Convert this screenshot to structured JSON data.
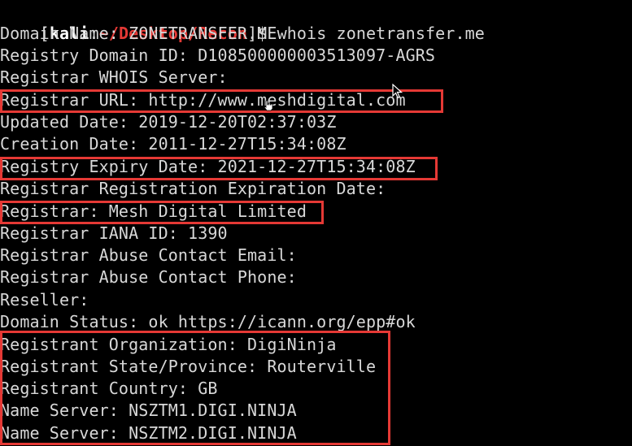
{
  "terminal": {
    "prompt": {
      "bracket_open": "[",
      "user": "kali",
      "separator": ":",
      "path": "~/Desktop/Recon",
      "bracket_close": "]$",
      "command": " whois zonetransfer.me"
    },
    "lines": [
      "Domain Name: ZONETRANSFER.ME",
      "Registry Domain ID: D108500000003513097-AGRS",
      "Registrar WHOIS Server:",
      "Registrar URL: http://www.meshdigital.com",
      "Updated Date: 2019-12-20T02:37:03Z",
      "Creation Date: 2011-12-27T15:34:08Z",
      "Registry Expiry Date: 2021-12-27T15:34:08Z",
      "Registrar Registration Expiration Date:",
      "Registrar: Mesh Digital Limited",
      "Registrar IANA ID: 1390",
      "Registrar Abuse Contact Email:",
      "Registrar Abuse Contact Phone:",
      "Reseller:",
      "Domain Status: ok https://icann.org/epp#ok",
      "Registrant Organization: DigiNinja",
      "Registrant State/Province: Routerville",
      "Registrant Country: GB",
      "Name Server: NSZTM1.DIGI.NINJA",
      "Name Server: NSZTM2.DIGI.NINJA"
    ]
  },
  "colors": {
    "background": "#000000",
    "text": "#d8d8d8",
    "prompt_path": "#e53935",
    "highlight_box": "#e53935"
  },
  "icons": {
    "mouse_pointer": "arrow-cursor-icon",
    "hand_pointer": "hand-cursor-icon"
  }
}
